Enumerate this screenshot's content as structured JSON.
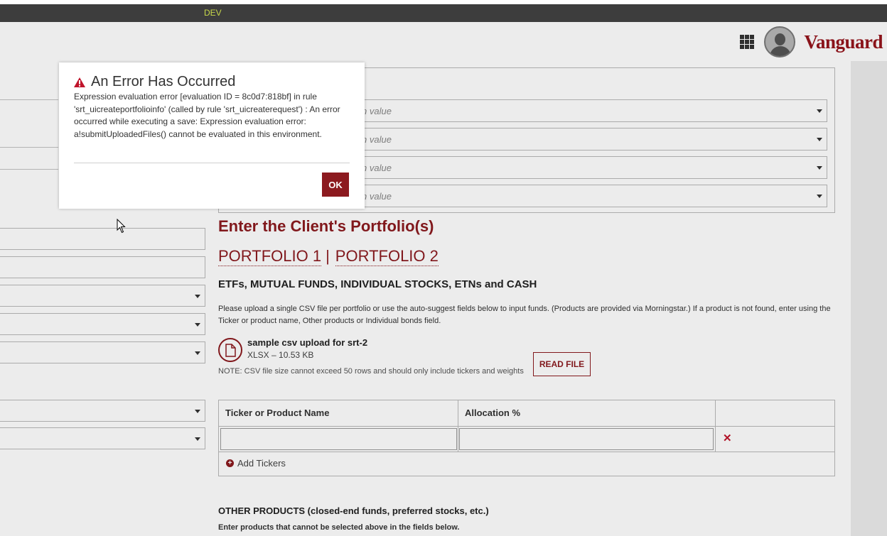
{
  "env": {
    "label": "DEV"
  },
  "header": {
    "brand": "Vanguard",
    "apps_icon": "grid-icon",
    "avatar_icon": "user-avatar-icon"
  },
  "dropdowns": {
    "placeholder": "n value"
  },
  "portfolio": {
    "heading": "Enter the Client's Portfolio(s)",
    "tabs": [
      "PORTFOLIO 1",
      "PORTFOLIO 2"
    ],
    "tab_separator": "|",
    "etf_heading": "ETFs, MUTUAL FUNDS, INDIVIDUAL STOCKS, ETNs and CASH",
    "instructions": "Please upload a single CSV file per portfolio or use the auto-suggest fields below to input funds. (Products are provided via Morningstar.) If a product is not found, enter using the Ticker or product name, Other products or Individual bonds field.",
    "file": {
      "name": "sample csv upload for srt-2",
      "meta": "XLSX – 10.53 KB",
      "icon": "document-icon"
    },
    "note": "NOTE: CSV file size cannot exceed 50 rows and should only include tickers and weights",
    "read_file_label": "READ FILE",
    "table": {
      "columns": [
        "Ticker or Product Name",
        "Allocation %"
      ],
      "delete_symbol": "✕",
      "add_label": "Add Tickers"
    },
    "other_heading": "OTHER PRODUCTS (closed-end funds, preferred stocks, etc.)",
    "other_sub": "Enter products that cannot be selected above in the fields below."
  },
  "dialog": {
    "title": "An Error Has Occurred",
    "message": "Expression evaluation error [evaluation ID = 8c0d7:818bf] in rule 'srt_uicreateportfolioinfo' (called by rule 'srt_uicreaterequest') : An error occurred while executing a save: Expression evaluation error: a!submitUploadedFiles() cannot be evaluated in this environment.",
    "ok_label": "OK",
    "icon": "warning-icon"
  },
  "colors": {
    "brand": "#96151d",
    "accent": "#8c1a1f",
    "env_bar": "#3d3d3d",
    "env_text": "#c8d84a"
  }
}
